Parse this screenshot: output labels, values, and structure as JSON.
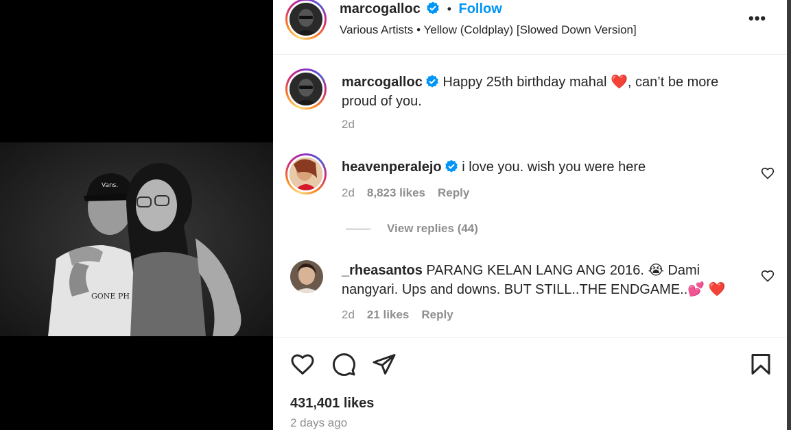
{
  "media": {
    "photo_caps_text": "Vans.",
    "shirt_text": "GONE PH"
  },
  "post": {
    "author": "marcogalloc",
    "follow_label": "Follow",
    "separator": "•",
    "audio": "Various Artists • Yellow (Coldplay) [Slowed Down Version]",
    "more_label": "•••"
  },
  "caption": {
    "username": "marcogalloc",
    "text_before": "Happy 25th birthday mahal",
    "emoji": "❤️",
    "text_after": ", can’t be more",
    "text_line2": "proud of you.",
    "time": "2d"
  },
  "comments": [
    {
      "username": "heavenperalejo",
      "text": "i love you. wish you were here",
      "time": "2d",
      "likes": "8,823 likes",
      "reply": "Reply",
      "view_replies": "View replies (44)"
    },
    {
      "username": "_rheasantos",
      "text_line1": "PARANG KELAN LANG ANG 2016. 😭  Dami",
      "text_line2": "nangyari. Ups and downs. BUT STILL..THE ENDGAME..💕 ❤️",
      "time": "2d",
      "likes": "21 likes",
      "reply": "Reply"
    }
  ],
  "footer": {
    "likes": "431,401 likes",
    "posted": "2 days ago"
  },
  "colors": {
    "accent": "#0095f6",
    "text": "#262626",
    "muted": "#8e8e8e"
  },
  "icons": [
    "heart-icon",
    "comment-icon",
    "share-icon",
    "bookmark-icon",
    "more-icon",
    "verified-badge-icon"
  ]
}
